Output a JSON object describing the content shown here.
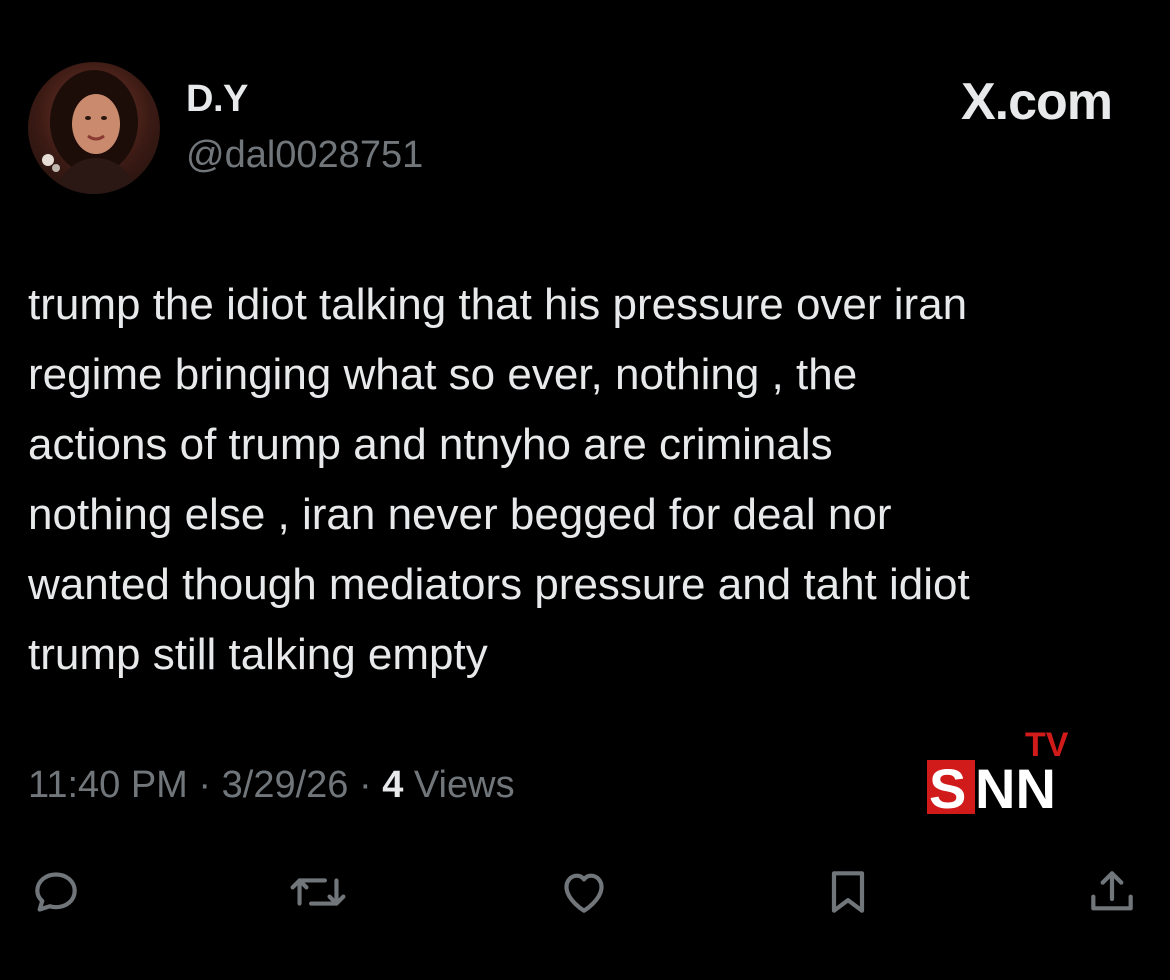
{
  "author": {
    "display_name": "D.Y",
    "handle": "@dal0028751"
  },
  "brand": {
    "label": "X.com"
  },
  "tweet": {
    "text": "trump the idiot talking that his pressure over iran\nregime bringing what so ever, nothing , the\nactions of trump and ntnyho are criminals\nnothing else , iran never begged for deal nor\nwanted though mediators pressure and taht idiot\ntrump still talking empty",
    "time": "11:40 PM",
    "date": "3/29/26",
    "separator": " · ",
    "views_count": "4",
    "views_label": " Views"
  },
  "watermark": {
    "tv": "TV",
    "s": "S",
    "nn": "NN"
  },
  "actions": [
    {
      "name": "reply",
      "icon": "reply-icon"
    },
    {
      "name": "repost",
      "icon": "repost-icon"
    },
    {
      "name": "like",
      "icon": "like-icon"
    },
    {
      "name": "bookmark",
      "icon": "bookmark-icon"
    },
    {
      "name": "share",
      "icon": "share-icon"
    }
  ],
  "colors": {
    "background": "#000000",
    "primary_text": "#e7e9ea",
    "secondary_text": "#71767b",
    "snn_red": "#d11a1a"
  }
}
